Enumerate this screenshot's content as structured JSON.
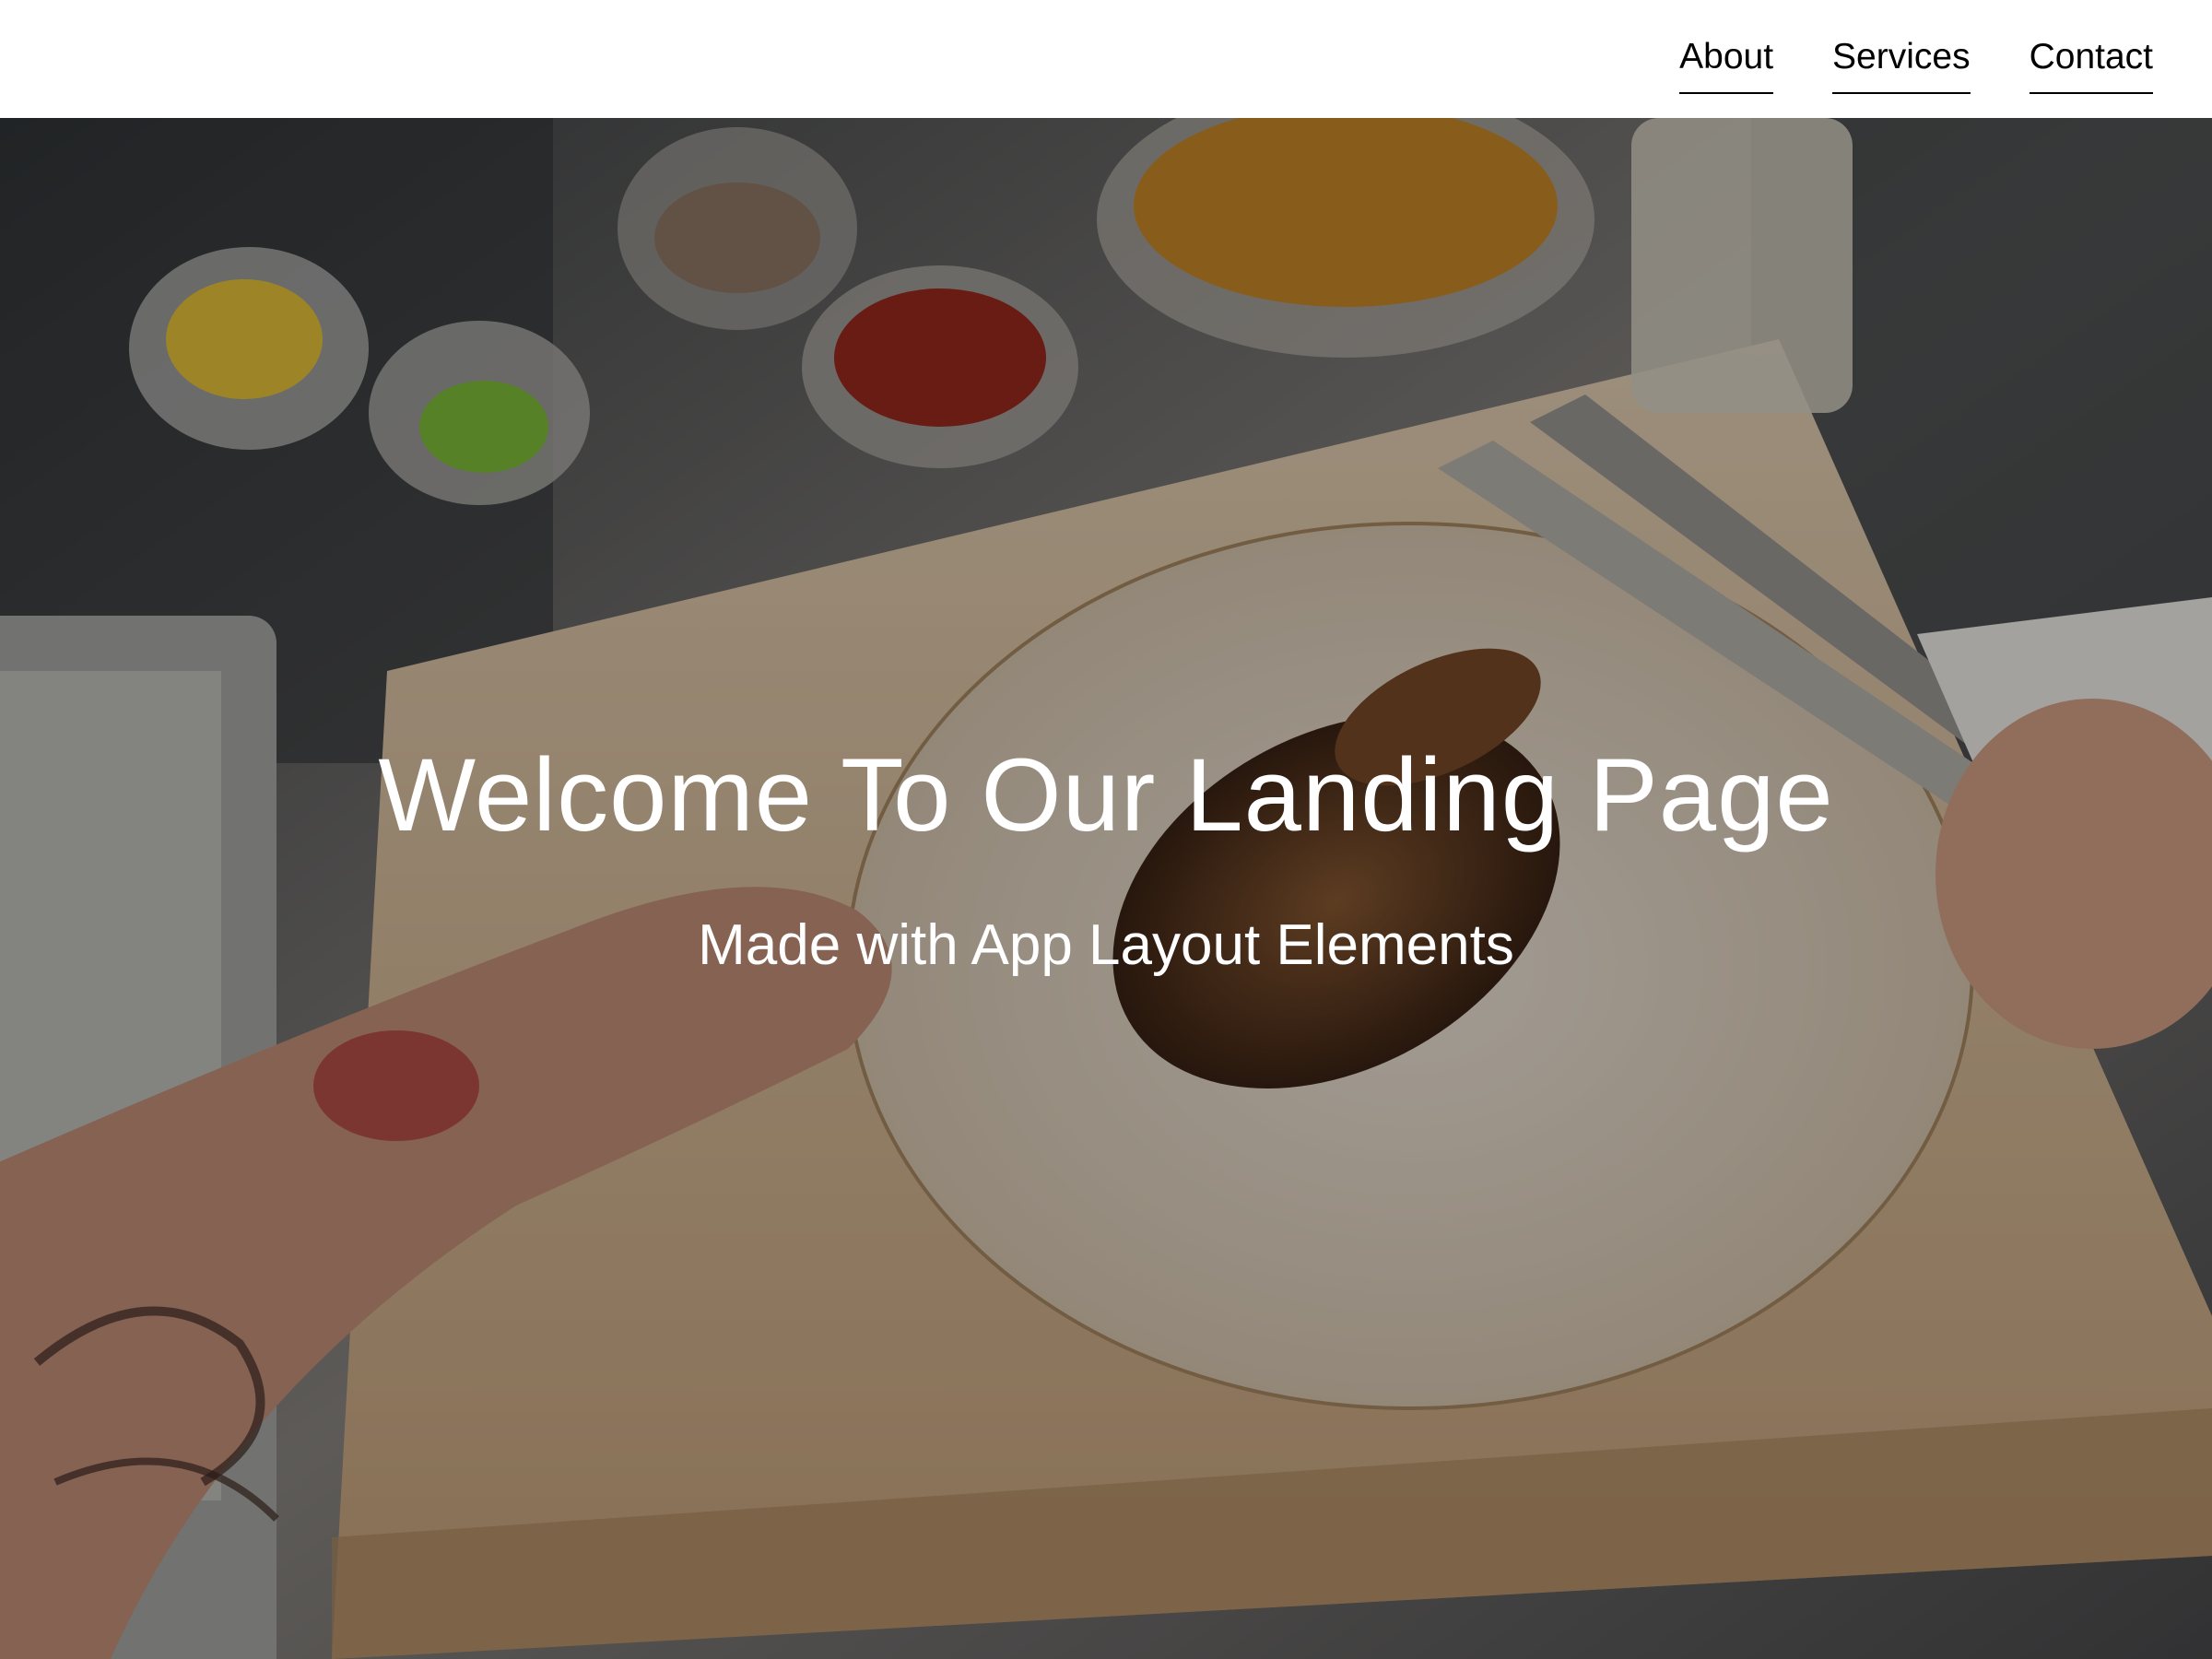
{
  "nav": {
    "items": [
      {
        "label": "About"
      },
      {
        "label": "Services"
      },
      {
        "label": "Contact"
      }
    ]
  },
  "hero": {
    "title": "Welcome To Our Landing Page",
    "subtitle": "Made with App Layout Elements",
    "background_image": "burrito-prep-photo",
    "overlay_color": "#000000"
  },
  "colors": {
    "header_bg": "#ffffff",
    "nav_text": "#000000",
    "hero_text": "#ffffff"
  }
}
